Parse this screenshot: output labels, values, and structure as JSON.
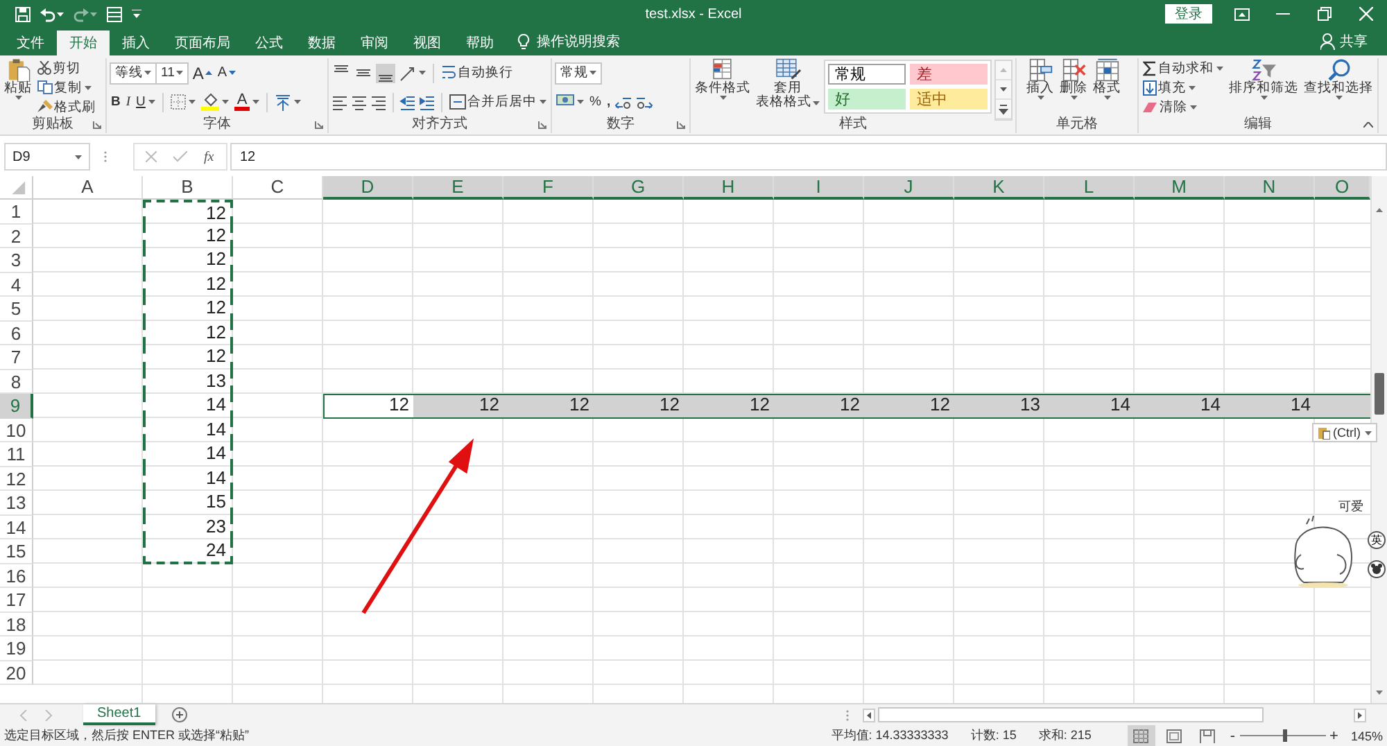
{
  "title_bar": {
    "title": "test.xlsx  -  Excel",
    "login": "登录"
  },
  "tabs": [
    {
      "label": "文件",
      "selected": false
    },
    {
      "label": "开始",
      "selected": true
    },
    {
      "label": "插入",
      "selected": false
    },
    {
      "label": "页面布局",
      "selected": false
    },
    {
      "label": "公式",
      "selected": false
    },
    {
      "label": "数据",
      "selected": false
    },
    {
      "label": "审阅",
      "selected": false
    },
    {
      "label": "视图",
      "selected": false
    },
    {
      "label": "帮助",
      "selected": false
    }
  ],
  "tell_me": "操作说明搜索",
  "share": "共享",
  "ribbon": {
    "clipboard": {
      "paste": "粘贴",
      "cut": "剪切",
      "copy": "复制",
      "format_painter": "格式刷",
      "label": "剪贴板"
    },
    "font": {
      "font_name": "等线",
      "font_size": "11",
      "grow": "A",
      "shrink": "A",
      "bold": "B",
      "italic": "I",
      "underline": "U",
      "font_color": "A",
      "label": "字体"
    },
    "alignment": {
      "vertical_align": [
        {
          "selected": false
        },
        {
          "selected": false
        },
        {
          "selected": true
        }
      ],
      "wrap_text": "自动换行",
      "merge_center": "合并后居中",
      "label": "对齐方式"
    },
    "number": {
      "format": "常规",
      "percent": "%",
      "comma": ",",
      "label": "数字"
    },
    "styles": {
      "conditional": "条件格式",
      "table_format": [
        "套用",
        "表格格式"
      ],
      "cell_styles": [
        {
          "label": "常规",
          "color": "#ffffff"
        },
        {
          "label": "差",
          "color": "#ffc7ce"
        },
        {
          "label": "好",
          "color": "#c6efce"
        },
        {
          "label": "适中",
          "color": "#ffeb9c"
        }
      ],
      "label": "样式"
    },
    "cells": {
      "insert": "插入",
      "delete": "删除",
      "format": "格式",
      "label": "单元格"
    },
    "editing": {
      "autosum": "自动求和",
      "fill": "填充",
      "clear": "清除",
      "sort_filter": "排序和筛选",
      "find_select": "查找和选择",
      "label": "编辑"
    }
  },
  "formula_bar": {
    "name_box": "D9",
    "function_label": "fx",
    "value": "12"
  },
  "columns": [
    {
      "label": "A",
      "selected": false
    },
    {
      "label": "B",
      "selected": false
    },
    {
      "label": "C",
      "selected": false
    },
    {
      "label": "D",
      "selected": true
    },
    {
      "label": "E",
      "selected": true
    },
    {
      "label": "F",
      "selected": true
    },
    {
      "label": "G",
      "selected": true
    },
    {
      "label": "H",
      "selected": true
    },
    {
      "label": "I",
      "selected": true
    },
    {
      "label": "J",
      "selected": true
    },
    {
      "label": "K",
      "selected": true
    },
    {
      "label": "L",
      "selected": true
    },
    {
      "label": "M",
      "selected": true
    },
    {
      "label": "N",
      "selected": true
    },
    {
      "label": "O",
      "selected": true
    }
  ],
  "rows": [
    {
      "label": "1",
      "selected": false,
      "cells": {
        "B": {
          "value": "12",
          "copied": true,
          "selected": false,
          "active": false
        }
      }
    },
    {
      "label": "2",
      "selected": false,
      "cells": {
        "B": {
          "value": "12",
          "copied": true,
          "selected": false,
          "active": false
        }
      }
    },
    {
      "label": "3",
      "selected": false,
      "cells": {
        "B": {
          "value": "12",
          "copied": true,
          "selected": false,
          "active": false
        }
      }
    },
    {
      "label": "4",
      "selected": false,
      "cells": {
        "B": {
          "value": "12",
          "copied": true,
          "selected": false,
          "active": false
        }
      }
    },
    {
      "label": "5",
      "selected": false,
      "cells": {
        "B": {
          "value": "12",
          "copied": true,
          "selected": false,
          "active": false
        }
      }
    },
    {
      "label": "6",
      "selected": false,
      "cells": {
        "B": {
          "value": "12",
          "copied": true,
          "selected": false,
          "active": false
        }
      }
    },
    {
      "label": "7",
      "selected": false,
      "cells": {
        "B": {
          "value": "12",
          "copied": true,
          "selected": false,
          "active": false
        }
      }
    },
    {
      "label": "8",
      "selected": false,
      "cells": {
        "B": {
          "value": "13",
          "copied": true,
          "selected": false,
          "active": false
        }
      }
    },
    {
      "label": "9",
      "selected": true,
      "cells": {
        "B": {
          "value": "14",
          "copied": true,
          "selected": false,
          "active": false
        },
        "D": {
          "value": "12",
          "copied": false,
          "selected": false,
          "active": true
        },
        "E": {
          "value": "12",
          "copied": false,
          "selected": true,
          "active": false
        },
        "F": {
          "value": "12",
          "copied": false,
          "selected": true,
          "active": false
        },
        "G": {
          "value": "12",
          "copied": false,
          "selected": true,
          "active": false
        },
        "H": {
          "value": "12",
          "copied": false,
          "selected": true,
          "active": false
        },
        "I": {
          "value": "12",
          "copied": false,
          "selected": true,
          "active": false
        },
        "J": {
          "value": "12",
          "copied": false,
          "selected": true,
          "active": false
        },
        "K": {
          "value": "13",
          "copied": false,
          "selected": true,
          "active": false
        },
        "L": {
          "value": "14",
          "copied": false,
          "selected": true,
          "active": false
        },
        "M": {
          "value": "14",
          "copied": false,
          "selected": true,
          "active": false
        },
        "N": {
          "value": "14",
          "copied": false,
          "selected": true,
          "active": false
        },
        "O": {
          "copied": false,
          "selected": true,
          "active": false
        }
      }
    },
    {
      "label": "10",
      "selected": false,
      "cells": {
        "B": {
          "value": "14",
          "copied": true,
          "selected": false,
          "active": false
        }
      }
    },
    {
      "label": "11",
      "selected": false,
      "cells": {
        "B": {
          "value": "14",
          "copied": true,
          "selected": false,
          "active": false
        }
      }
    },
    {
      "label": "12",
      "selected": false,
      "cells": {
        "B": {
          "value": "14",
          "copied": true,
          "selected": false,
          "active": false
        }
      }
    },
    {
      "label": "13",
      "selected": false,
      "cells": {
        "B": {
          "value": "15",
          "copied": true,
          "selected": false,
          "active": false
        }
      }
    },
    {
      "label": "14",
      "selected": false,
      "cells": {
        "B": {
          "value": "23",
          "copied": true,
          "selected": false,
          "active": false
        }
      }
    },
    {
      "label": "15",
      "selected": false,
      "cells": {
        "B": {
          "value": "24",
          "copied": true,
          "selected": false,
          "active": false
        }
      }
    },
    {
      "label": "16",
      "selected": false
    },
    {
      "label": "17",
      "selected": false
    },
    {
      "label": "18",
      "selected": false
    },
    {
      "label": "19",
      "selected": false
    },
    {
      "label": "20",
      "selected": false
    }
  ],
  "paste_options": "(Ctrl)",
  "sticker": {
    "kind": "picture",
    "caption": "可爱"
  },
  "ime_mode": "英",
  "sheets": [
    {
      "label": "Sheet1",
      "selected": true
    }
  ],
  "status_bar": {
    "message": "选定目标区域，然后按 ENTER 或选择“粘贴”",
    "average": "平均值: 14.33333333",
    "count": "计数: 15",
    "sum": "求和: 215",
    "views": [
      {
        "kind": "normal",
        "selected": true
      },
      {
        "kind": "page_layout",
        "selected": false
      },
      {
        "kind": "page_break",
        "selected": false
      }
    ],
    "zoom_out": "-",
    "zoom": {
      "level": 0.53
    },
    "zoom_in": "+",
    "zoom_percent": "145%"
  }
}
